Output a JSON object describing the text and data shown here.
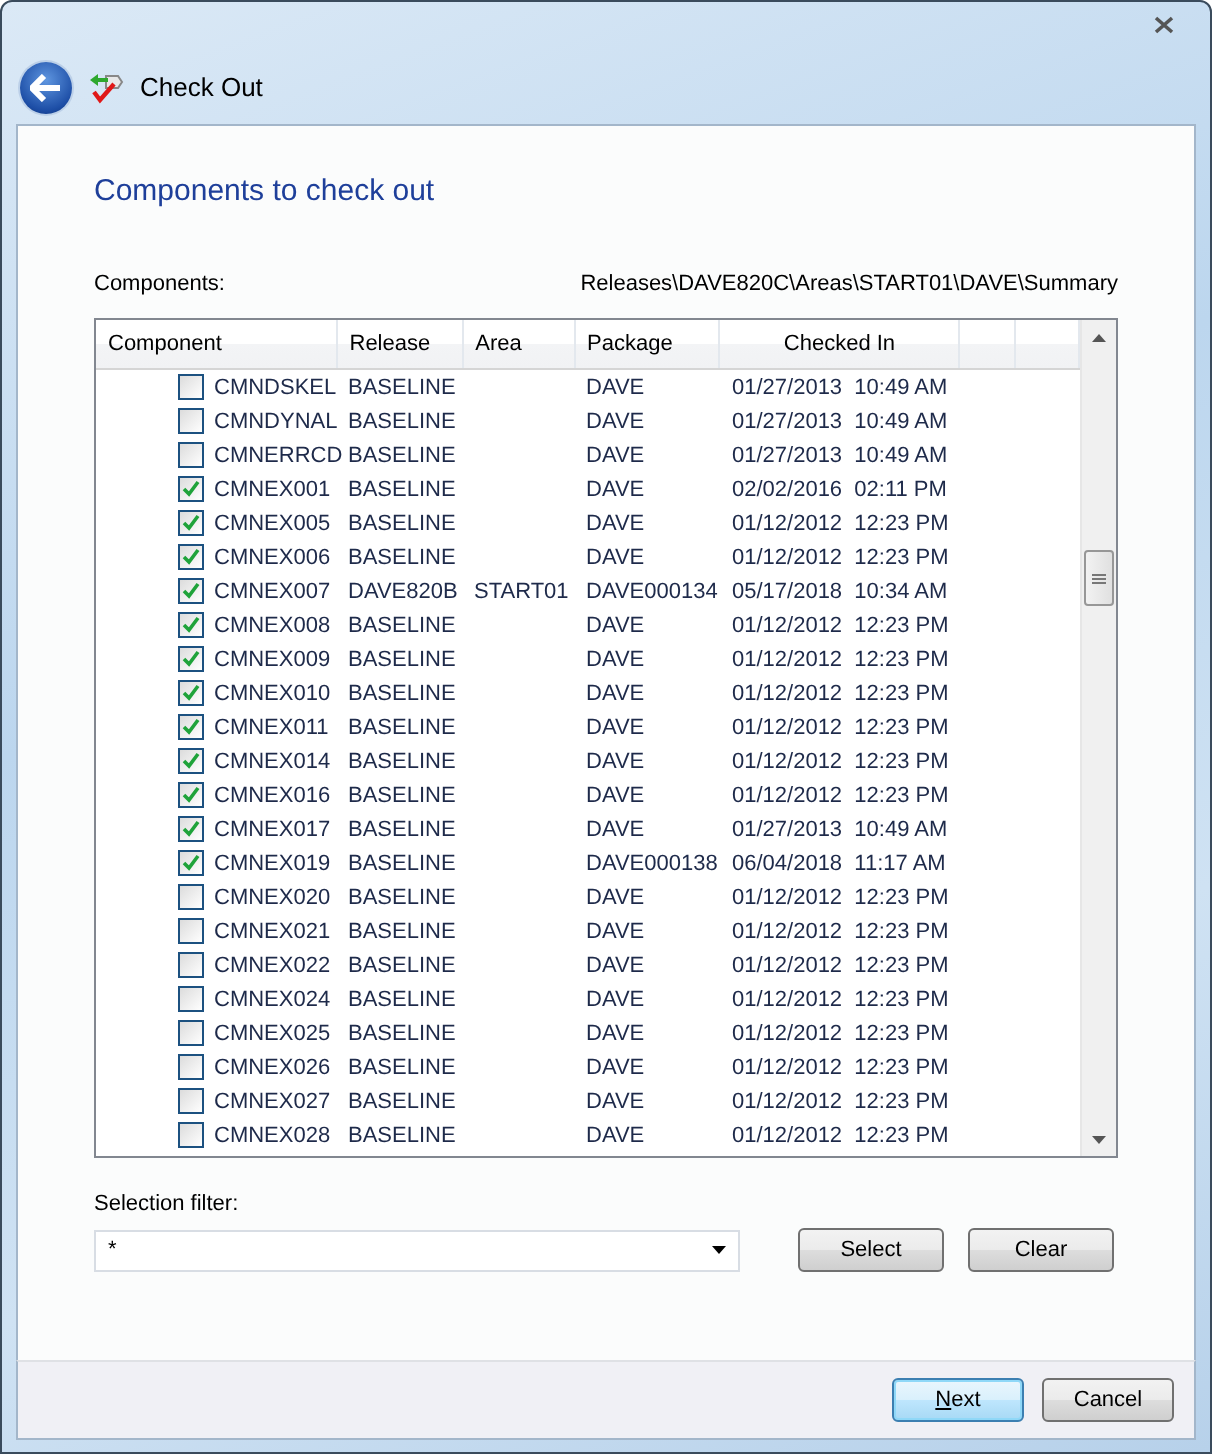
{
  "window": {
    "title": "Check Out"
  },
  "heading": "Components to check out",
  "components_label": "Components:",
  "path": "Releases\\DAVE820C\\Areas\\START01\\DAVE\\Summary",
  "table": {
    "columns": [
      "Component",
      "Release",
      "Area",
      "Package",
      "Checked In"
    ],
    "rows": [
      {
        "checked": false,
        "component": "CMNDSKEL",
        "release": "BASELINE",
        "area": "",
        "package": "DAVE",
        "checked_in": "01/27/2013  10:49 AM"
      },
      {
        "checked": false,
        "component": "CMNDYNAL",
        "release": "BASELINE",
        "area": "",
        "package": "DAVE",
        "checked_in": "01/27/2013  10:49 AM"
      },
      {
        "checked": false,
        "component": "CMNERRCD",
        "release": "BASELINE",
        "area": "",
        "package": "DAVE",
        "checked_in": "01/27/2013  10:49 AM"
      },
      {
        "checked": true,
        "component": "CMNEX001",
        "release": "BASELINE",
        "area": "",
        "package": "DAVE",
        "checked_in": "02/02/2016  02:11 PM"
      },
      {
        "checked": true,
        "component": "CMNEX005",
        "release": "BASELINE",
        "area": "",
        "package": "DAVE",
        "checked_in": "01/12/2012  12:23 PM"
      },
      {
        "checked": true,
        "component": "CMNEX006",
        "release": "BASELINE",
        "area": "",
        "package": "DAVE",
        "checked_in": "01/12/2012  12:23 PM"
      },
      {
        "checked": true,
        "component": "CMNEX007",
        "release": "DAVE820B",
        "area": "START01",
        "package": "DAVE000134",
        "checked_in": "05/17/2018  10:34 AM"
      },
      {
        "checked": true,
        "component": "CMNEX008",
        "release": "BASELINE",
        "area": "",
        "package": "DAVE",
        "checked_in": "01/12/2012  12:23 PM"
      },
      {
        "checked": true,
        "component": "CMNEX009",
        "release": "BASELINE",
        "area": "",
        "package": "DAVE",
        "checked_in": "01/12/2012  12:23 PM"
      },
      {
        "checked": true,
        "component": "CMNEX010",
        "release": "BASELINE",
        "area": "",
        "package": "DAVE",
        "checked_in": "01/12/2012  12:23 PM"
      },
      {
        "checked": true,
        "component": "CMNEX011",
        "release": "BASELINE",
        "area": "",
        "package": "DAVE",
        "checked_in": "01/12/2012  12:23 PM"
      },
      {
        "checked": true,
        "component": "CMNEX014",
        "release": "BASELINE",
        "area": "",
        "package": "DAVE",
        "checked_in": "01/12/2012  12:23 PM"
      },
      {
        "checked": true,
        "component": "CMNEX016",
        "release": "BASELINE",
        "area": "",
        "package": "DAVE",
        "checked_in": "01/12/2012  12:23 PM"
      },
      {
        "checked": true,
        "component": "CMNEX017",
        "release": "BASELINE",
        "area": "",
        "package": "DAVE",
        "checked_in": "01/27/2013  10:49 AM"
      },
      {
        "checked": true,
        "component": "CMNEX019",
        "release": "BASELINE",
        "area": "",
        "package": "DAVE000138",
        "checked_in": "06/04/2018  11:17 AM"
      },
      {
        "checked": false,
        "component": "CMNEX020",
        "release": "BASELINE",
        "area": "",
        "package": "DAVE",
        "checked_in": "01/12/2012  12:23 PM"
      },
      {
        "checked": false,
        "component": "CMNEX021",
        "release": "BASELINE",
        "area": "",
        "package": "DAVE",
        "checked_in": "01/12/2012  12:23 PM"
      },
      {
        "checked": false,
        "component": "CMNEX022",
        "release": "BASELINE",
        "area": "",
        "package": "DAVE",
        "checked_in": "01/12/2012  12:23 PM"
      },
      {
        "checked": false,
        "component": "CMNEX024",
        "release": "BASELINE",
        "area": "",
        "package": "DAVE",
        "checked_in": "01/12/2012  12:23 PM"
      },
      {
        "checked": false,
        "component": "CMNEX025",
        "release": "BASELINE",
        "area": "",
        "package": "DAVE",
        "checked_in": "01/12/2012  12:23 PM"
      },
      {
        "checked": false,
        "component": "CMNEX026",
        "release": "BASELINE",
        "area": "",
        "package": "DAVE",
        "checked_in": "01/12/2012  12:23 PM"
      },
      {
        "checked": false,
        "component": "CMNEX027",
        "release": "BASELINE",
        "area": "",
        "package": "DAVE",
        "checked_in": "01/12/2012  12:23 PM"
      },
      {
        "checked": false,
        "component": "CMNEX028",
        "release": "BASELINE",
        "area": "",
        "package": "DAVE",
        "checked_in": "01/12/2012  12:23 PM"
      }
    ]
  },
  "selection_filter": {
    "label": "Selection filter:",
    "value": "*"
  },
  "filter_buttons": [
    "Select",
    "Clear"
  ],
  "footer_buttons": [
    {
      "label": "Next",
      "default": true
    },
    {
      "label": "Cancel",
      "default": false
    }
  ]
}
